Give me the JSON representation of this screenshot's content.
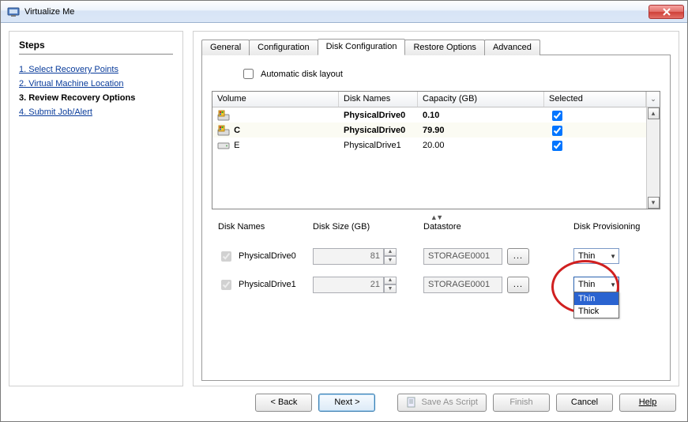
{
  "window": {
    "title": "Virtualize Me"
  },
  "steps": {
    "heading": "Steps",
    "items": [
      {
        "label": "1. Select Recovery Points",
        "current": false
      },
      {
        "label": "2. Virtual Machine Location",
        "current": false
      },
      {
        "label": "3. Review Recovery Options",
        "current": true
      },
      {
        "label": "4. Submit Job/Alert",
        "current": false
      }
    ]
  },
  "tabs": {
    "items": [
      "General",
      "Configuration",
      "Disk Configuration",
      "Restore Options",
      "Advanced"
    ],
    "active_index": 2
  },
  "auto_layout": {
    "label": "Automatic disk layout",
    "checked": false
  },
  "vol_table": {
    "headers": {
      "volume": "Volume",
      "disk": "Disk Names",
      "capacity": "Capacity (GB)",
      "selected": "Selected"
    },
    "rows": [
      {
        "vol": "",
        "disk": "PhysicalDrive0",
        "cap": "0.10",
        "checked": true,
        "bold": true,
        "icon": "win"
      },
      {
        "vol": "C",
        "disk": "PhysicalDrive0",
        "cap": "79.90",
        "checked": true,
        "bold": true,
        "icon": "win"
      },
      {
        "vol": "E",
        "disk": "PhysicalDrive1",
        "cap": "20.00",
        "checked": true,
        "bold": false,
        "icon": "hdd"
      }
    ]
  },
  "lower": {
    "headers": {
      "disk": "Disk Names",
      "size": "Disk Size (GB)",
      "store": "Datastore",
      "prov": "Disk Provisioning"
    },
    "rows": [
      {
        "name": "PhysicalDrive0",
        "checked": true,
        "size": "81",
        "store": "STORAGE0001",
        "prov": "Thin",
        "open": false
      },
      {
        "name": "PhysicalDrive1",
        "checked": true,
        "size": "21",
        "store": "STORAGE0001",
        "prov": "Thin",
        "open": true
      }
    ],
    "prov_options": [
      "Thin",
      "Thick"
    ],
    "browse_label": "..."
  },
  "footer": {
    "back": "< Back",
    "next": "Next >",
    "save_script": "Save As Script",
    "finish": "Finish",
    "cancel": "Cancel",
    "help": "Help"
  }
}
